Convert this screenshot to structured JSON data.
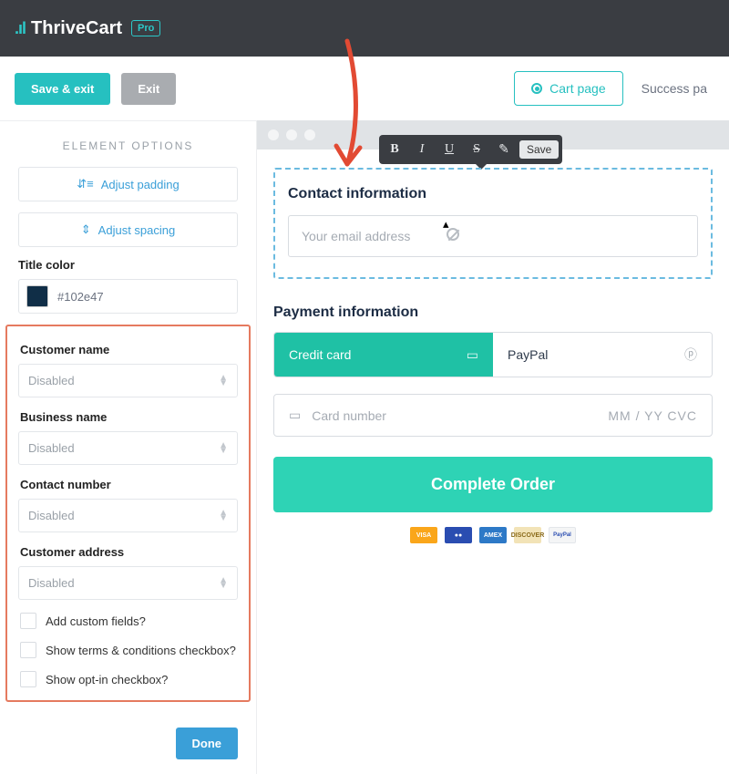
{
  "brand": {
    "name": "ThriveCart",
    "badge": "Pro"
  },
  "toolbar": {
    "save_exit": "Save & exit",
    "exit": "Exit",
    "cart_page": "Cart page",
    "success_page": "Success pa"
  },
  "sidebar": {
    "title": "ELEMENT OPTIONS",
    "adjust_padding": "Adjust padding",
    "adjust_spacing": "Adjust spacing",
    "title_color_label": "Title color",
    "title_color_value": "#102e47",
    "fields": {
      "customer_name": {
        "label": "Customer name",
        "value": "Disabled"
      },
      "business_name": {
        "label": "Business name",
        "value": "Disabled"
      },
      "contact_number": {
        "label": "Contact number",
        "value": "Disabled"
      },
      "customer_address": {
        "label": "Customer address",
        "value": "Disabled"
      }
    },
    "checks": {
      "add_custom": "Add custom fields?",
      "show_terms": "Show terms & conditions checkbox?",
      "show_optin": "Show opt-in checkbox?"
    },
    "done": "Done"
  },
  "text_toolbar": {
    "save": "Save"
  },
  "preview": {
    "contact_title": "Contact information",
    "email_placeholder": "Your email address",
    "payment_title": "Payment information",
    "tab_cc": "Credit card",
    "tab_pp": "PayPal",
    "card_placeholder": "Card number",
    "card_right": "MM / YY  CVC",
    "complete": "Complete Order",
    "brands": {
      "visa": "VISA",
      "mc": "●●",
      "amex": "AMEX",
      "disc": "DISCOVER",
      "pp": "PayPal"
    }
  }
}
